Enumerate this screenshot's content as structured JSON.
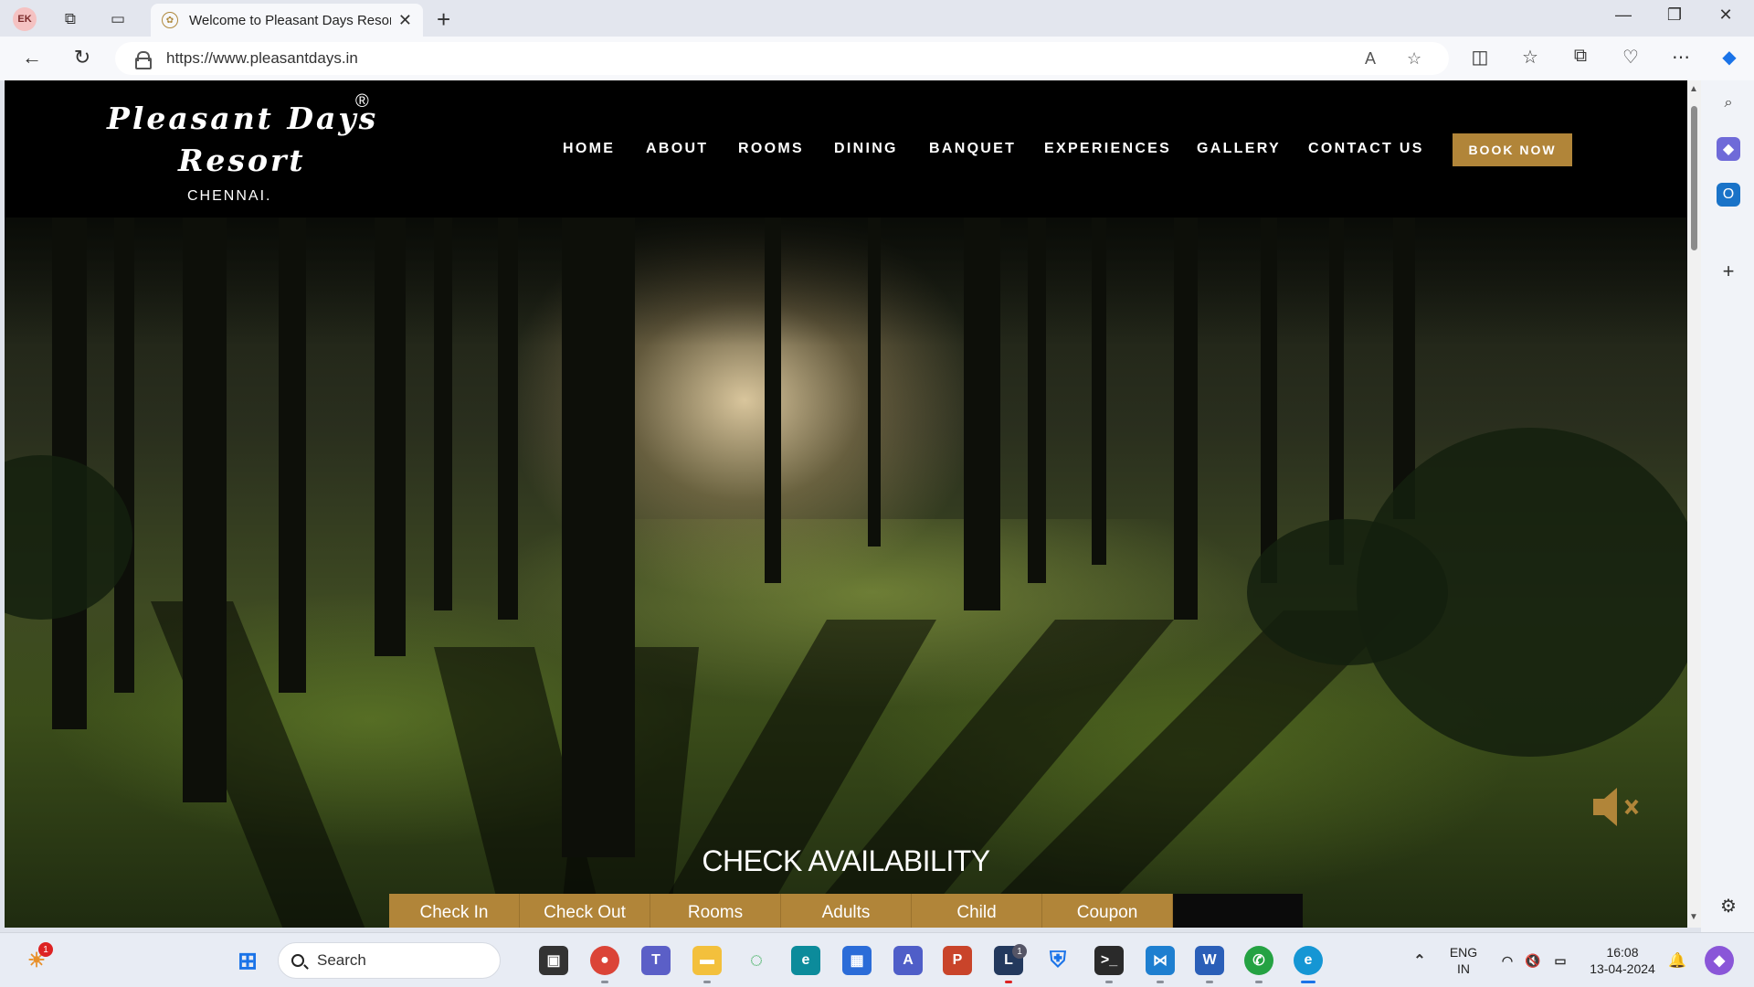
{
  "browser": {
    "profile_initials": "EK",
    "tab_title": "Welcome to Pleasant Days Resor",
    "url": "https://www.pleasantdays.in"
  },
  "site": {
    "logo_line1": "Pleasant Days",
    "logo_line2": "Resort",
    "logo_reg": "®",
    "logo_city": "CHENNAI.",
    "menu": [
      {
        "label": "HOME"
      },
      {
        "label": "ABOUT"
      },
      {
        "label": "ROOMS"
      },
      {
        "label": "DINING"
      },
      {
        "label": "BANQUET"
      },
      {
        "label": "EXPERIENCES"
      },
      {
        "label": "GALLERY"
      },
      {
        "label": "CONTACT US"
      }
    ],
    "book_now": "BOOK NOW",
    "check_availability": "CHECK AVAILABILITY",
    "booking_fields": [
      "Check In",
      "Check Out",
      "Rooms",
      "Adults",
      "Child",
      "Coupon"
    ],
    "accent_color": "#b18539"
  },
  "taskbar": {
    "search_placeholder": "Search",
    "lang_line1": "ENG",
    "lang_line2": "IN",
    "time": "16:08",
    "date": "13-04-2024",
    "weather_badge": "1",
    "lync_badge": "1"
  }
}
